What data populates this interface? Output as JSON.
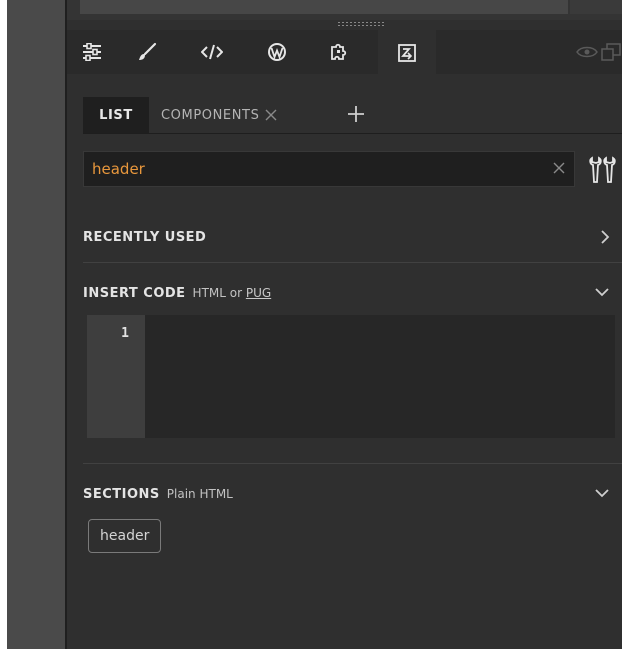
{
  "toolbar": {
    "buttons": [
      {
        "name": "settings-sliders-icon"
      },
      {
        "name": "brush-icon"
      },
      {
        "name": "code-icon"
      },
      {
        "name": "wordpress-icon"
      },
      {
        "name": "puzzle-icon"
      },
      {
        "name": "insert-panel-icon",
        "active": true
      }
    ],
    "right_icons": [
      "eye-icon",
      "window-icon"
    ]
  },
  "tabs": {
    "list_label": "LIST",
    "components_label": "COMPONENTS"
  },
  "search": {
    "value": "header"
  },
  "recently_used": {
    "title": "RECENTLY USED"
  },
  "insert_code": {
    "title": "INSERT CODE",
    "subtitle_prefix": "HTML or",
    "subtitle_link": "PUG",
    "line_number": "1"
  },
  "sections": {
    "title": "SECTIONS",
    "subtitle": "Plain HTML",
    "chip_label": "header"
  },
  "colors": {
    "accent_orange": "#e8973c",
    "panel_bg": "#2f2f2f",
    "toolbar_bg": "#2a2a2a"
  }
}
